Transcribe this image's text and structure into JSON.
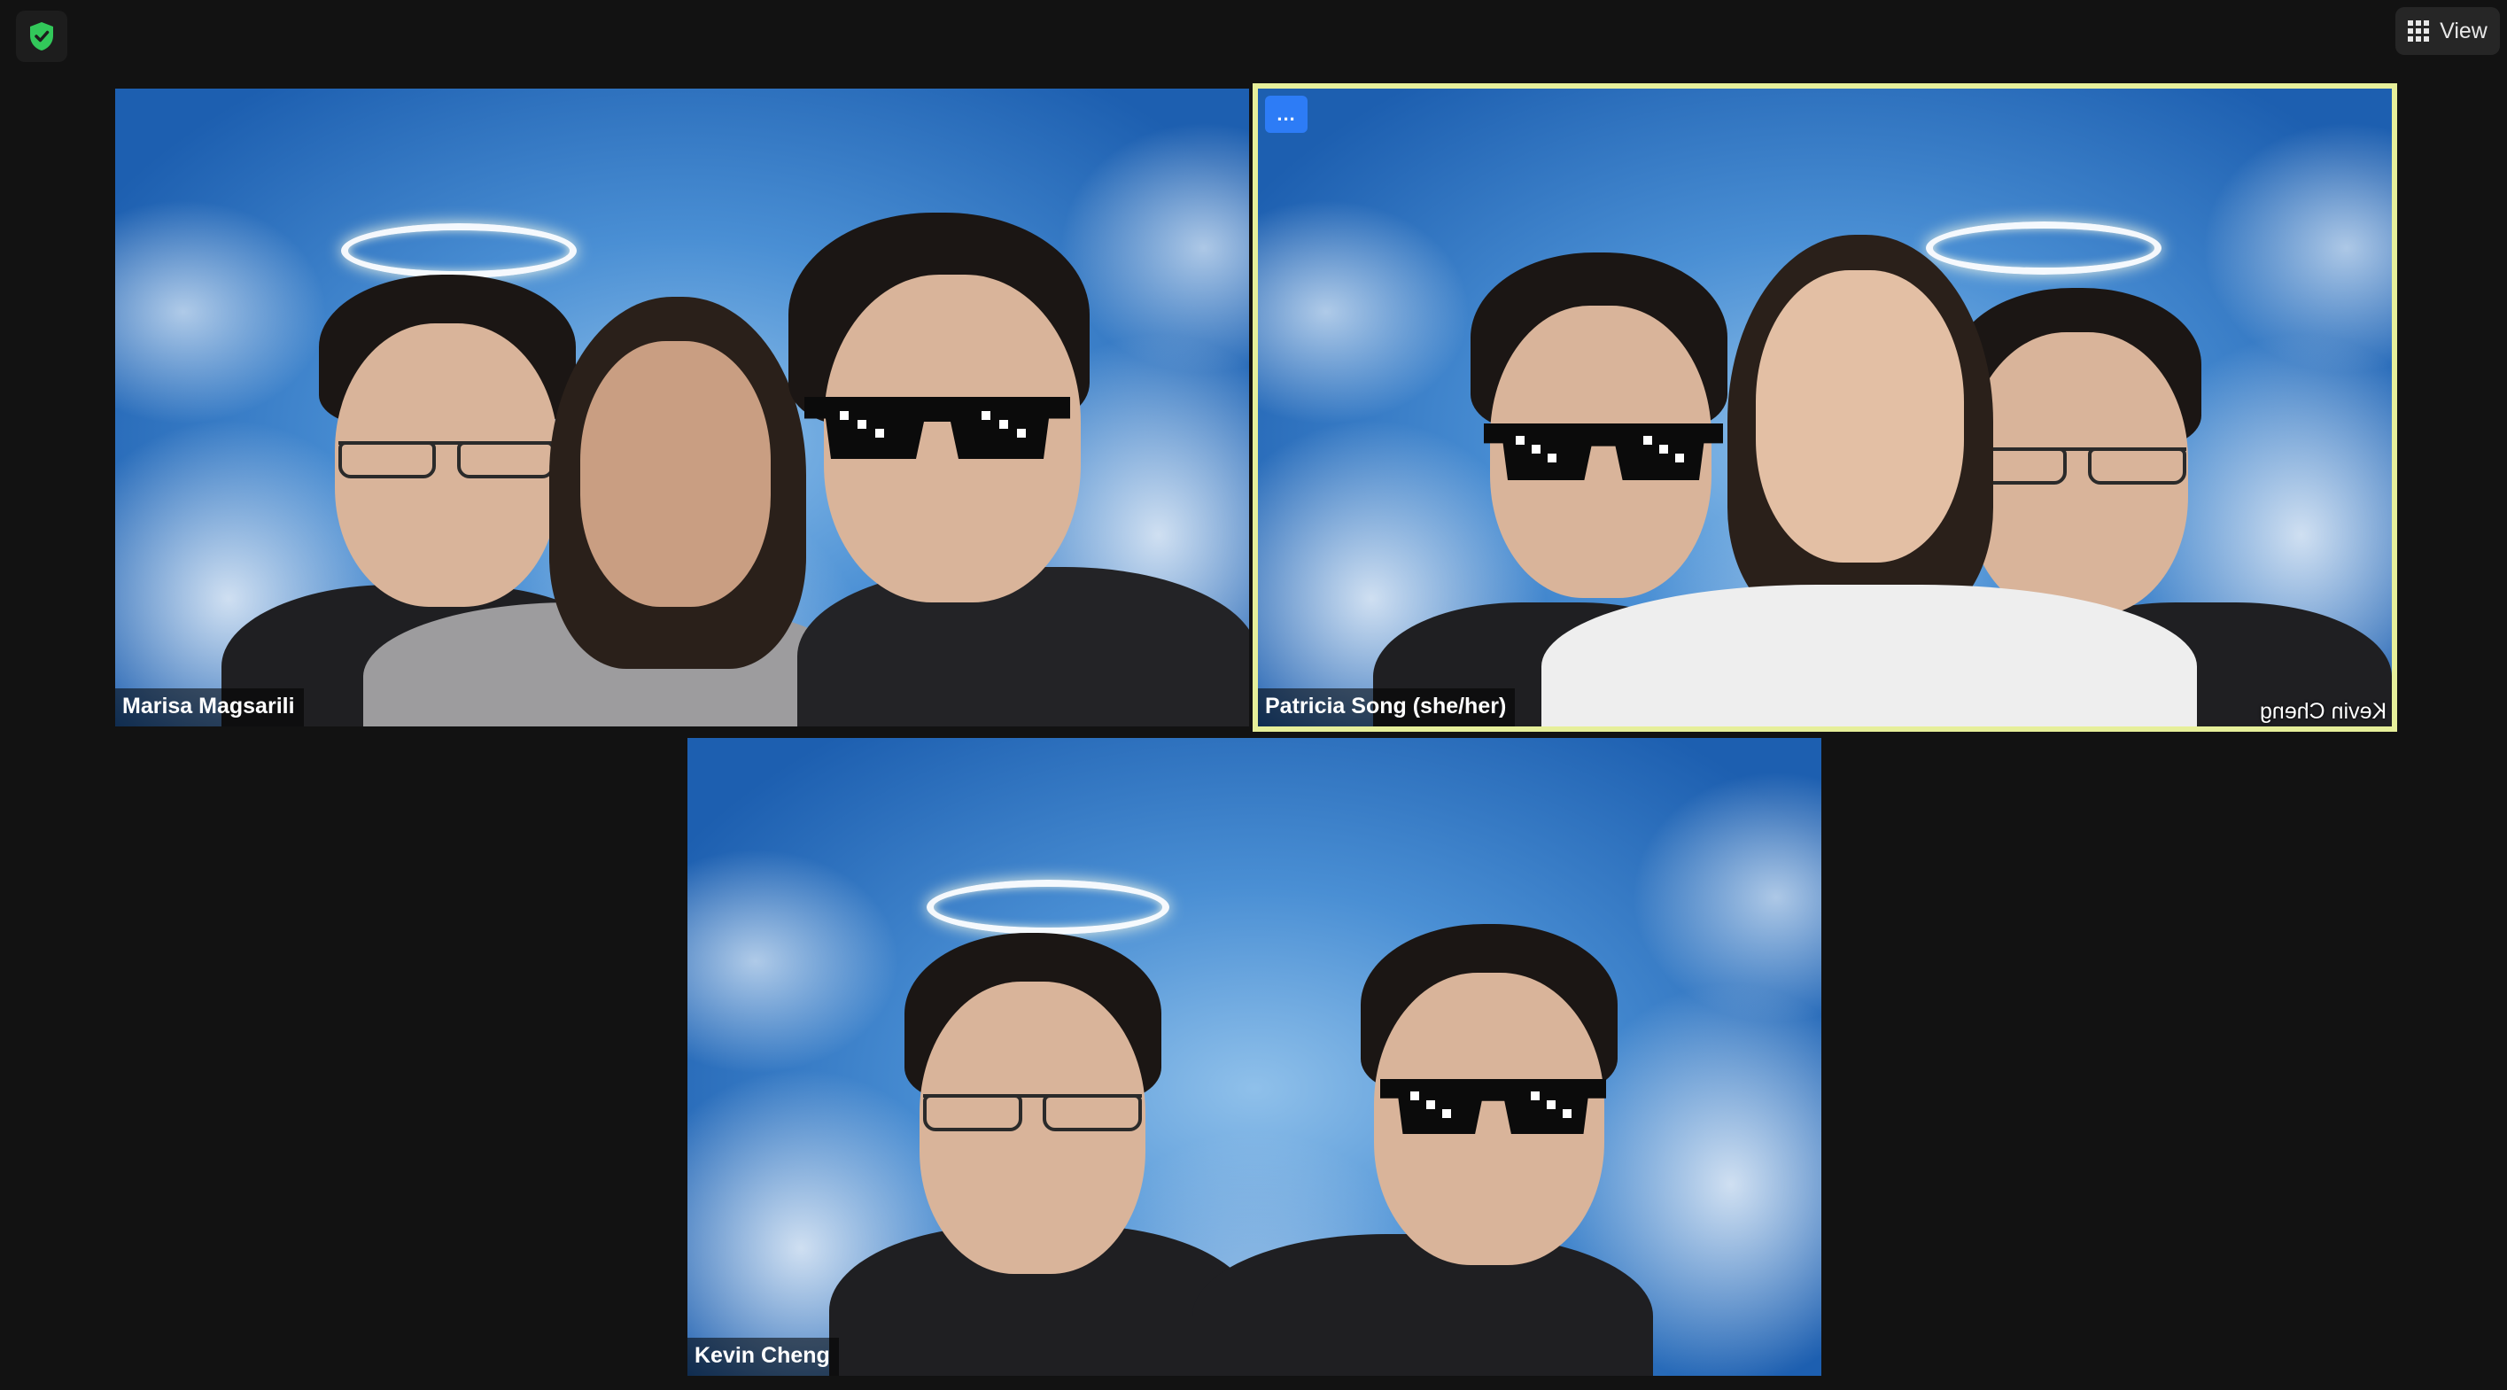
{
  "toolbar": {
    "security_icon": "shield-check-icon",
    "security_color": "#32c85a",
    "view_label": "View",
    "view_icon": "grid-icon"
  },
  "tiles": [
    {
      "name": "Marisa Magsarili",
      "active": false
    },
    {
      "name": "Patricia Song (she/her)",
      "active": true,
      "more_label": "...",
      "mirror_text": "Kevin Cheng",
      "accent": "#e6ef9a"
    },
    {
      "name": "Kevin Cheng",
      "active": false
    }
  ]
}
